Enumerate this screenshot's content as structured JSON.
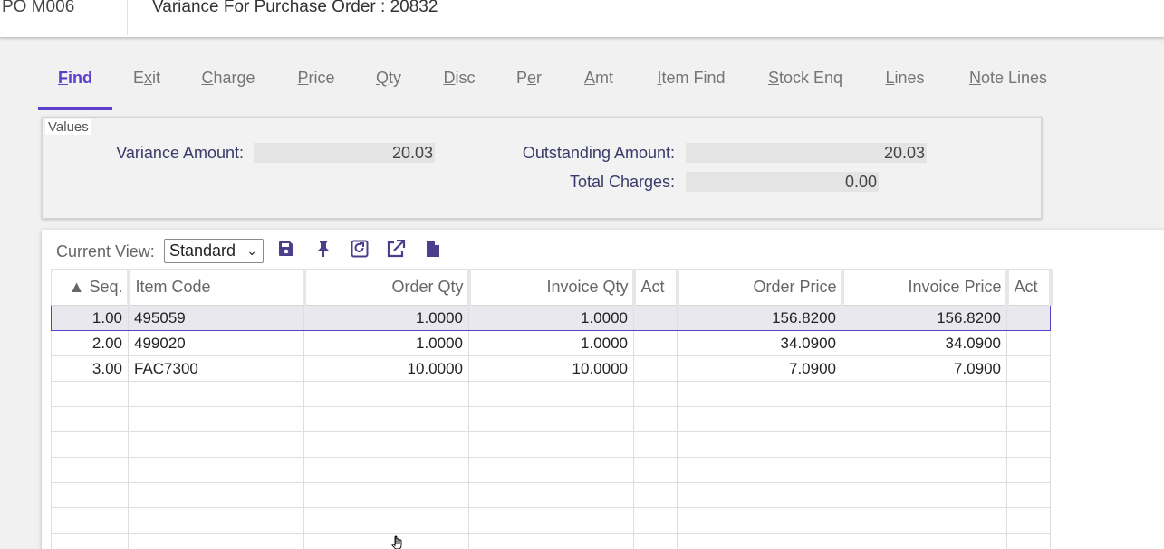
{
  "header": {
    "code": "PO M006",
    "title": "Variance For Purchase Order : 20832"
  },
  "tabs": [
    {
      "label": "Find",
      "accel": "F",
      "active": true
    },
    {
      "label": "Exit",
      "accel": "x",
      "active": false
    },
    {
      "label": "Charge",
      "accel": "C",
      "active": false
    },
    {
      "label": "Price",
      "accel": "P",
      "active": false
    },
    {
      "label": "Qty",
      "accel": "Q",
      "active": false
    },
    {
      "label": "Disc",
      "accel": "D",
      "active": false
    },
    {
      "label": "Per",
      "accel": "e",
      "active": false
    },
    {
      "label": "Amt",
      "accel": "A",
      "active": false
    },
    {
      "label": "Item Find",
      "accel": "I",
      "active": false
    },
    {
      "label": "Stock Enq",
      "accel": "S",
      "active": false
    },
    {
      "label": "Lines",
      "accel": "L",
      "active": false
    },
    {
      "label": "Note Lines",
      "accel": "N",
      "active": false
    }
  ],
  "values": {
    "legend": "Values",
    "variance_amount_label": "Variance Amount:",
    "variance_amount": "20.03",
    "outstanding_amount_label": "Outstanding Amount:",
    "outstanding_amount": "20.03",
    "total_charges_label": "Total Charges:",
    "total_charges": "0.00"
  },
  "view": {
    "label": "Current View:",
    "selected": "Standard",
    "toolbar_icons": [
      "save-icon",
      "pin-icon",
      "reset-view-icon",
      "export-icon",
      "document-icon"
    ]
  },
  "grid": {
    "columns": [
      {
        "label": "▲ Seq.",
        "align": "right"
      },
      {
        "label": "Item Code",
        "align": "left"
      },
      {
        "label": "Order Qty",
        "align": "right"
      },
      {
        "label": "Invoice Qty",
        "align": "right"
      },
      {
        "label": "Act",
        "align": "left"
      },
      {
        "label": "Order Price",
        "align": "right"
      },
      {
        "label": "Invoice Price",
        "align": "right"
      },
      {
        "label": "Act",
        "align": "left"
      }
    ],
    "rows": [
      {
        "seq": "1.00",
        "item_code": "495059",
        "order_qty": "1.0000",
        "invoice_qty": "1.0000",
        "act1": "",
        "order_price": "156.8200",
        "invoice_price": "156.8200",
        "act2": "",
        "selected": true
      },
      {
        "seq": "2.00",
        "item_code": "499020",
        "order_qty": "1.0000",
        "invoice_qty": "1.0000",
        "act1": "",
        "order_price": "34.0900",
        "invoice_price": "34.0900",
        "act2": "",
        "selected": false
      },
      {
        "seq": "3.00",
        "item_code": "FAC7300",
        "order_qty": "10.0000",
        "invoice_qty": "10.0000",
        "act1": "",
        "order_price": "7.0900",
        "invoice_price": "7.0900",
        "act2": "",
        "selected": false
      }
    ],
    "empty_rows": 7
  },
  "colors": {
    "accent": "#5c3fc9",
    "icon": "#4a3f8a"
  }
}
